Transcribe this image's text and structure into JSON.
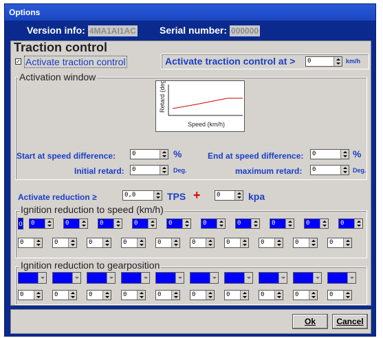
{
  "window": {
    "title": "Options"
  },
  "header": {
    "version_label": "Version info:",
    "version_value": "4MA1AI1AC",
    "serial_label": "Serial number:",
    "serial_value": "000000"
  },
  "traction": {
    "title": "Traction control",
    "activate_checkbox_label": "Activate traction control",
    "activate_at_label": "Activate traction control at >",
    "activate_at_value": "0",
    "activate_at_unit": "km/h",
    "window_title": "Activation window",
    "graph_ylabel": "Retard (deg.",
    "graph_xlabel": "Speed (km/h)",
    "start_label": "Start at speed difference:",
    "start_value": "0",
    "start_unit": "%",
    "end_label": "End at speed difference:",
    "end_value": "0",
    "end_unit": "%",
    "initial_label": "Initial retard:",
    "initial_value": "0",
    "initial_unit": "Deg.",
    "max_label": "maximum retard:",
    "max_value": "0",
    "max_unit": "Deg."
  },
  "reduction": {
    "label": "Activate reduction ≥",
    "tps_value": "0,0",
    "tps_unit": "TPS",
    "plus": "+",
    "kpa_value": "0",
    "kpa_unit": "kpa"
  },
  "speed_group": {
    "title": "Ignition reduction to speed (km/h)",
    "first_value": "0",
    "top_values": [
      "0",
      "0",
      "0",
      "0",
      "0",
      "0",
      "0",
      "0",
      "0",
      "0"
    ],
    "bottom_values": [
      "0",
      "0",
      "0",
      "0",
      "0",
      "0",
      "0",
      "0",
      "0",
      "0"
    ]
  },
  "gear_group": {
    "title": "Ignition reduction to gearposition",
    "bottom_values": [
      "0",
      "0",
      "0",
      "0",
      "0",
      "0",
      "0",
      "0",
      "0",
      "0"
    ]
  },
  "buttons": {
    "ok": "Ok",
    "cancel": "Cancel"
  },
  "colors": {
    "accent": "#0000ff",
    "label_blue": "#1a3ec8",
    "window_bg": "#0a2a8e"
  }
}
